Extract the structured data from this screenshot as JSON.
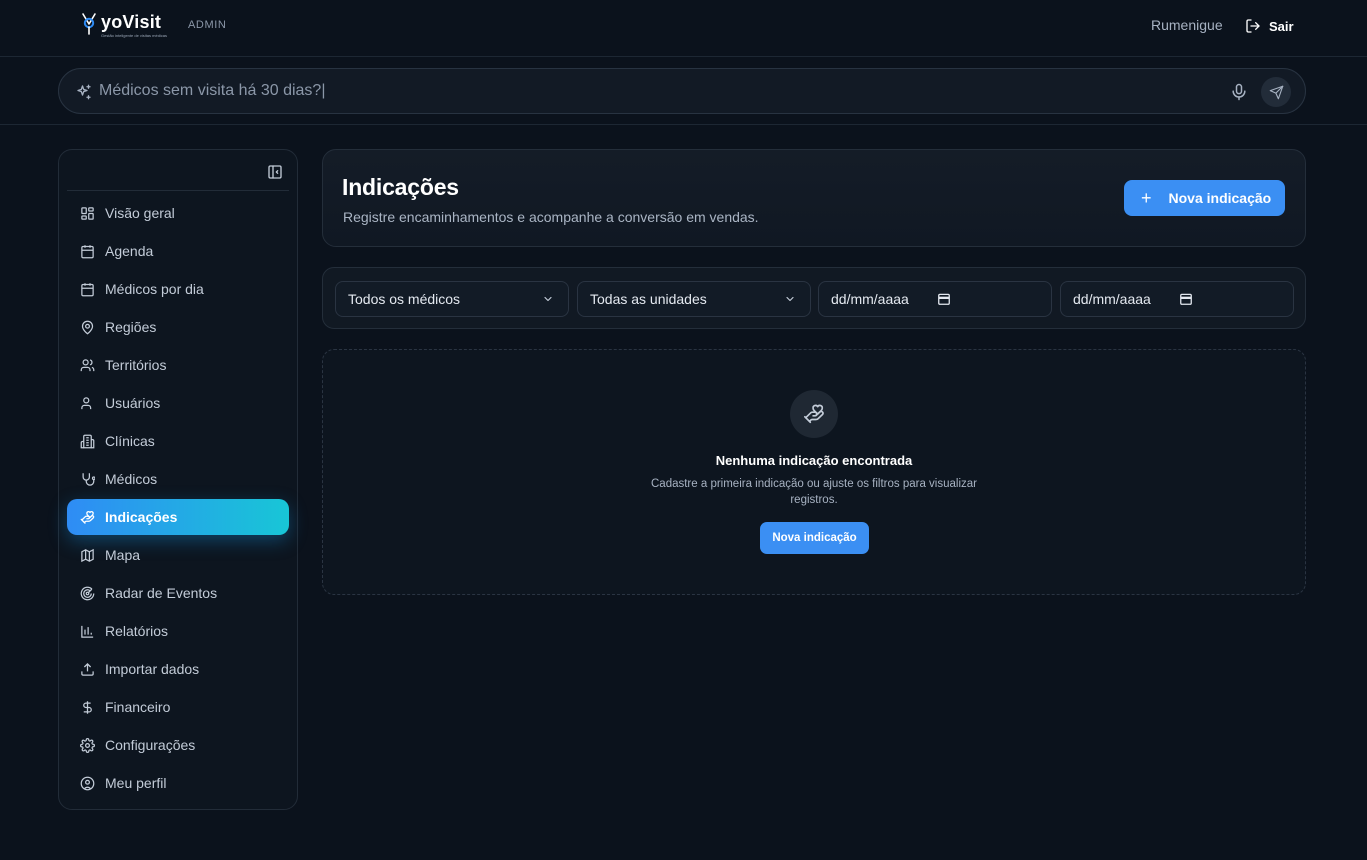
{
  "brand": {
    "name": "yoVisit",
    "tagline": "Gestão inteligente de visitas médicas"
  },
  "header": {
    "role": "ADMIN",
    "user_name": "Rumenigue",
    "logout_label": "Sair"
  },
  "ask": {
    "placeholder": "Médicos sem visita há 30 dias?|"
  },
  "sidebar": {
    "items": [
      {
        "label": "Visão geral",
        "icon": "layout-grid-icon",
        "active": false
      },
      {
        "label": "Agenda",
        "icon": "calendar-icon",
        "active": false
      },
      {
        "label": "Médicos por dia",
        "icon": "calendar-days-icon",
        "active": false
      },
      {
        "label": "Regiões",
        "icon": "map-pin-icon",
        "active": false
      },
      {
        "label": "Territórios",
        "icon": "users-icon",
        "active": false
      },
      {
        "label": "Usuários",
        "icon": "user-icon",
        "active": false
      },
      {
        "label": "Clínicas",
        "icon": "building-icon",
        "active": false
      },
      {
        "label": "Médicos",
        "icon": "stethoscope-icon",
        "active": false
      },
      {
        "label": "Indicações",
        "icon": "hand-heart-icon",
        "active": true
      },
      {
        "label": "Mapa",
        "icon": "map-icon",
        "active": false
      },
      {
        "label": "Radar de Eventos",
        "icon": "radar-icon",
        "active": false
      },
      {
        "label": "Relatórios",
        "icon": "bar-chart-icon",
        "active": false
      },
      {
        "label": "Importar dados",
        "icon": "upload-icon",
        "active": false
      },
      {
        "label": "Financeiro",
        "icon": "dollar-icon",
        "active": false
      },
      {
        "label": "Configurações",
        "icon": "gear-icon",
        "active": false
      },
      {
        "label": "Meu perfil",
        "icon": "user-circle-icon",
        "active": false
      }
    ]
  },
  "page": {
    "title": "Indicações",
    "subtitle": "Registre encaminhamentos e acompanhe a conversão em vendas.",
    "new_button": "Nova indicação"
  },
  "filters": {
    "doctor": "Todos os médicos",
    "unit": "Todas as unidades",
    "date_from": "dd/mm/aaaa",
    "date_to": "dd/mm/aaaa"
  },
  "empty_state": {
    "title": "Nenhuma indicação encontrada",
    "text": "Cadastre a primeira indicação ou ajuste os filtros para visualizar registros.",
    "button": "Nova indicação"
  },
  "colors": {
    "accent": "#3b8ff3",
    "accent_gradient_end": "#18c6d6",
    "background": "#0b121c"
  }
}
